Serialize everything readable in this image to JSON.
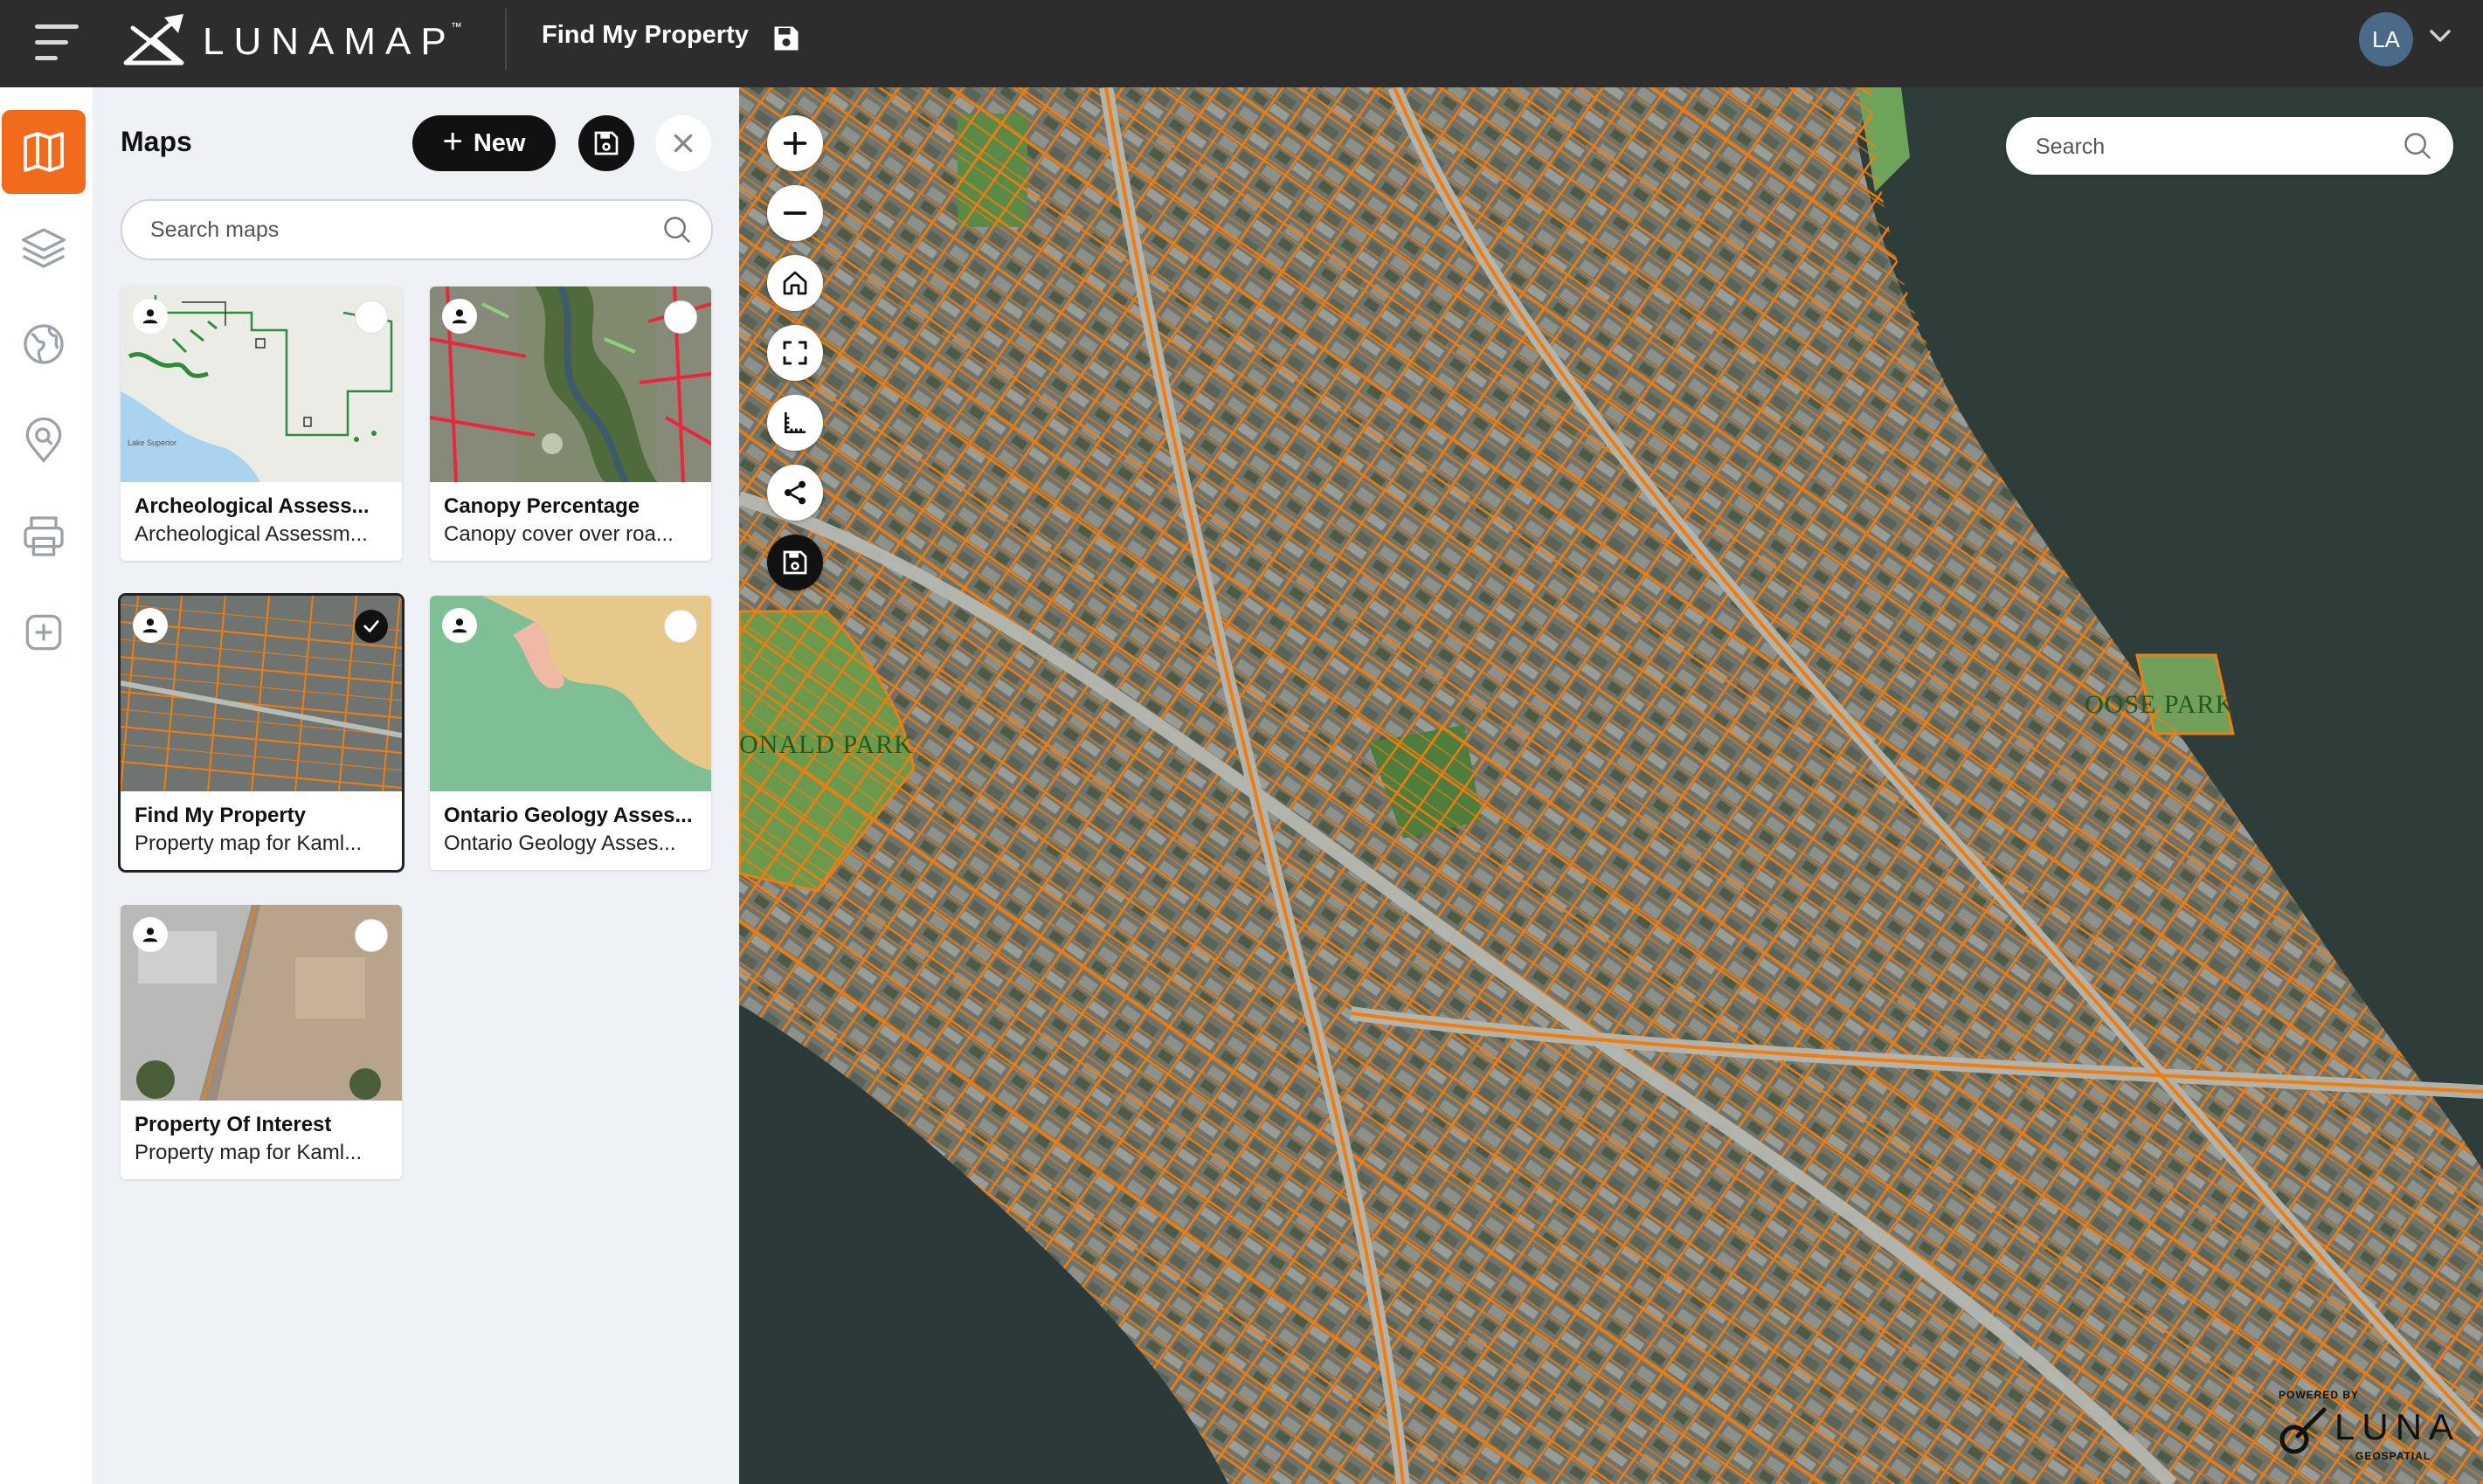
{
  "topbar": {
    "logo_text": "LUNAMAP",
    "logo_tm": "™",
    "map_title": "Find My Property",
    "user_initials": "LA"
  },
  "rail": {
    "items": [
      "maps-icon",
      "layers-icon",
      "globe-icon",
      "search-location-icon",
      "print-icon",
      "add-icon"
    ]
  },
  "panel": {
    "title": "Maps",
    "new_label": "New",
    "search_placeholder": "Search maps",
    "cards": [
      {
        "title": "Archeological Assess...",
        "desc": "Archeological Assessm...",
        "selected": false
      },
      {
        "title": "Canopy Percentage",
        "desc": "Canopy cover over roa...",
        "selected": false
      },
      {
        "title": "Find My Property",
        "desc": "Property map for Kaml...",
        "selected": true
      },
      {
        "title": "Ontario Geology Asses...",
        "desc": "Ontario Geology Asses...",
        "selected": false
      },
      {
        "title": "Property Of Interest",
        "desc": "Property map for Kaml...",
        "selected": false
      }
    ]
  },
  "map": {
    "search_placeholder": "Search",
    "thumb_label": "Lake Superior",
    "park_labels": [
      "ONALD PARK",
      "OOSE PARK"
    ],
    "controls": [
      "zoom-in-icon",
      "zoom-out-icon",
      "home-icon",
      "fullscreen-icon",
      "measure-icon",
      "share-icon",
      "save-icon"
    ],
    "powered_by": "POWERED BY",
    "powered_brand": "LUNA",
    "powered_sub": "GEOSPATIAL"
  },
  "colors": {
    "accent": "#f26a1b",
    "topbar": "#2d2d2d",
    "parcel": "#f07d12",
    "panel_bg": "#eef1f5"
  }
}
